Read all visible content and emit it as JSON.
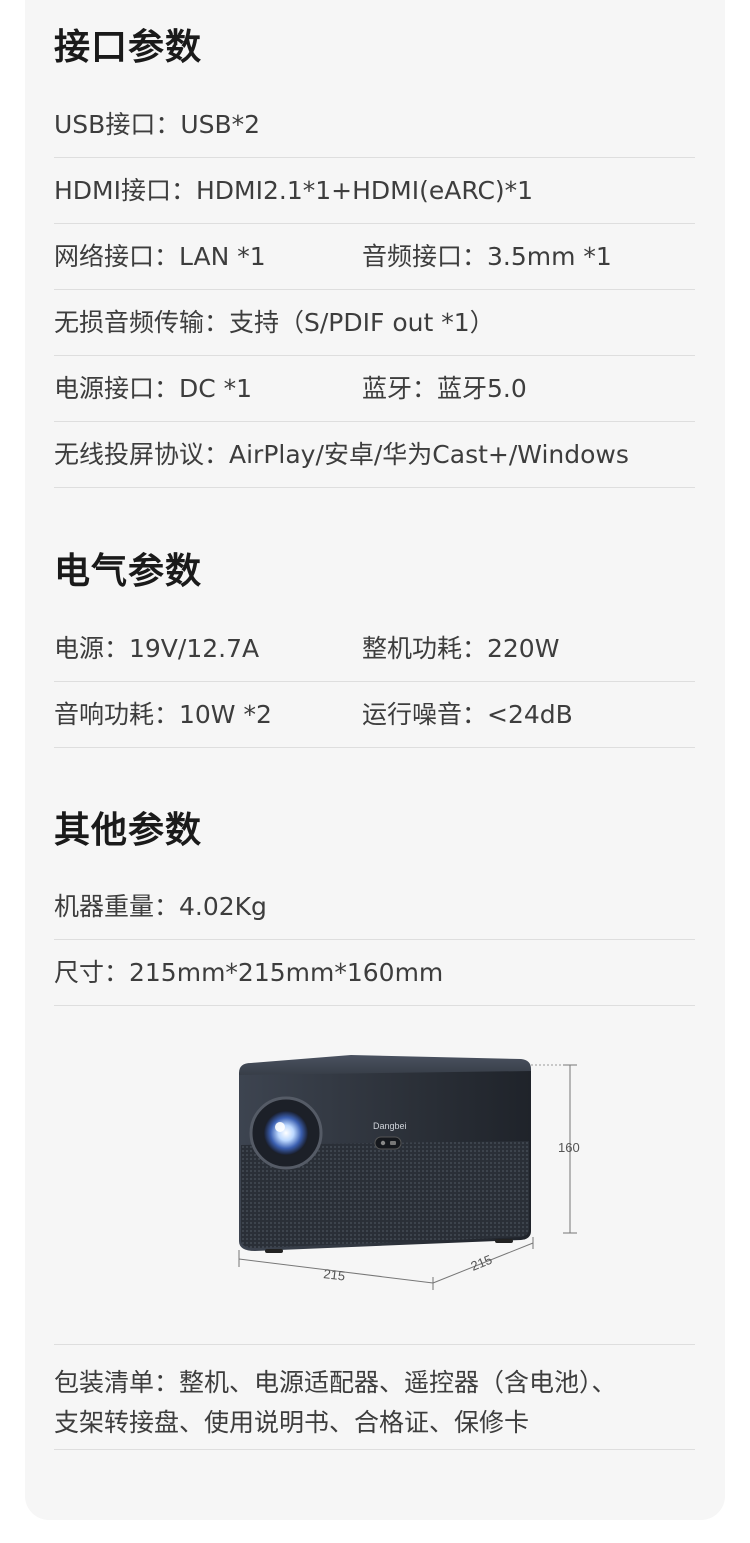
{
  "sections": [
    {
      "title": "接口参数",
      "rows": [
        {
          "left": "USB接口：USB*2"
        },
        {
          "left": "HDMI接口：HDMI2.1*1+HDMI(eARC)*1"
        },
        {
          "left": "网络接口：LAN *1",
          "right": "音频接口：3.5mm *1"
        },
        {
          "left": "无损音频传输：支持（S/PDIF out *1）"
        },
        {
          "left": "电源接口：DC *1",
          "right": "蓝牙：蓝牙5.0"
        },
        {
          "left": "无线投屏协议：AirPlay/安卓/华为Cast+/Windows"
        }
      ]
    },
    {
      "title": "电气参数",
      "rows": [
        {
          "left": "电源：19V/12.7A",
          "right": "整机功耗：220W"
        },
        {
          "left": "音响功耗：10W *2",
          "right": "运行噪音：<24dB"
        }
      ]
    },
    {
      "title": "其他参数",
      "rows": [
        {
          "left": "机器重量：4.02Kg"
        },
        {
          "left": "尺寸：215mm*215mm*160mm"
        }
      ]
    }
  ],
  "product_image": {
    "brand_text": "Dangbei",
    "height_label": "160",
    "width_label": "215",
    "depth_label": "215"
  },
  "package_list": {
    "line1": "包装清单：整机、电源适配器、遥控器（含电池）、",
    "line2": "支架转接盘、使用说明书、合格证、保修卡"
  }
}
